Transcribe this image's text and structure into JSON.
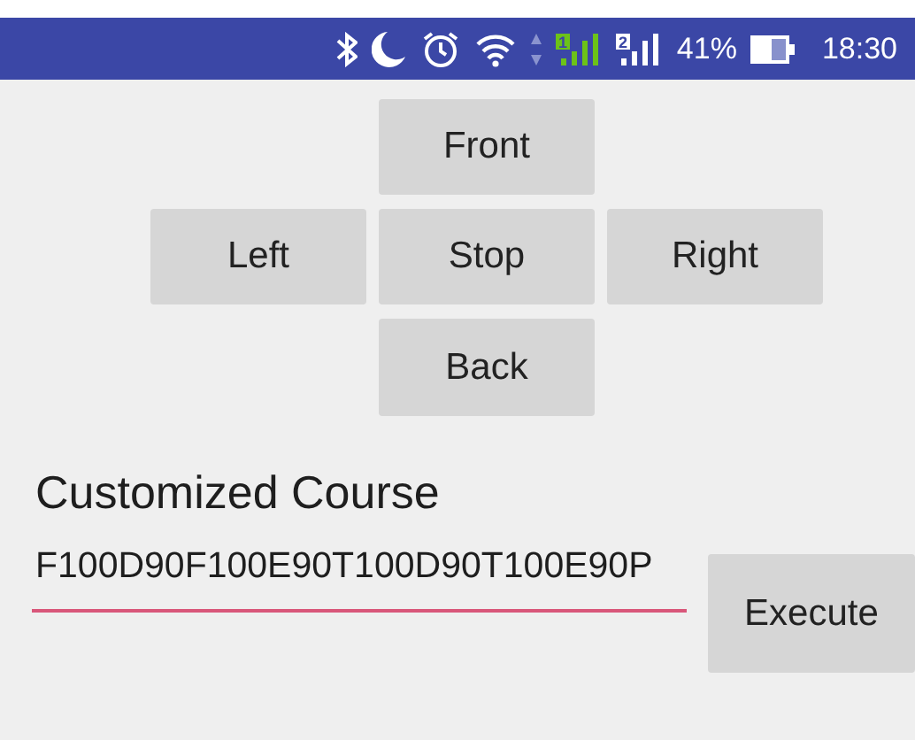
{
  "status_bar": {
    "sims": [
      {
        "label": "1",
        "color": "#6cc219"
      },
      {
        "label": "2",
        "color": "#ffffff"
      }
    ],
    "battery": "41%",
    "time": "18:30"
  },
  "controls": [
    {
      "label": "Front",
      "kind": "front"
    },
    {
      "label": "Left",
      "kind": "left"
    },
    {
      "label": "Stop",
      "kind": "stop"
    },
    {
      "label": "Right",
      "kind": "right"
    },
    {
      "label": "Back",
      "kind": "back"
    }
  ],
  "course": {
    "title": "Customized Course",
    "value": "F100D90F100E90T100D90T100E90P",
    "button": "Execute"
  }
}
